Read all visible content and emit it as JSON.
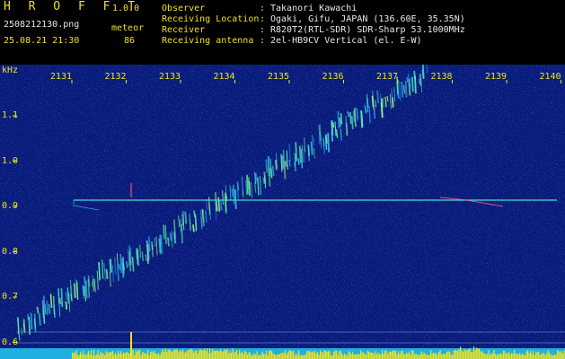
{
  "app": {
    "logo": "H R O F F T",
    "version": "1.0.0"
  },
  "file": {
    "name": "2508212130.png",
    "datetime": "25.08.21 21:30"
  },
  "meteor": {
    "label": "meteor",
    "count": "86"
  },
  "info": [
    {
      "label": "Observer",
      "value": "Takanori Kawachi"
    },
    {
      "label": "Receiving Location",
      "value": "Ogaki, Gifu, JAPAN (136.60E, 35.35N)"
    },
    {
      "label": "Receiver",
      "value": "R820T2(RTL-SDR) SDR-Sharp 53.1000MHz"
    },
    {
      "label": "Receiving antenna",
      "value": "2el-HB9CV Vertical (el. E-W)"
    }
  ],
  "separator": ":",
  "axis": {
    "unit": "kHz",
    "time_ticks": [
      "2131",
      "2132",
      "2133",
      "2134",
      "2135",
      "2136",
      "2137",
      "2138",
      "2139",
      "2140"
    ],
    "freq_ticks": [
      "1.1",
      "1.0",
      "0.9",
      "0.8",
      "0.7",
      "0.6"
    ]
  },
  "colors": {
    "background": "#000000",
    "spectrogram_base": "#0a1a7a",
    "text_yellow": "#f0e020",
    "text_white": "#e8e8e8",
    "carrier_line": "#40e0d0"
  }
}
